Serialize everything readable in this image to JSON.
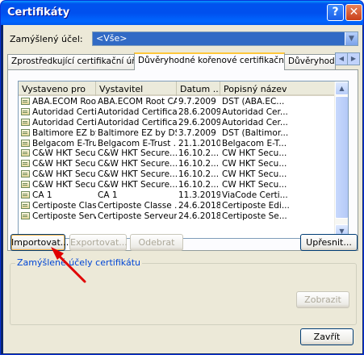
{
  "window": {
    "title": "Certifikáty",
    "help_label": "?",
    "close_label": "✕"
  },
  "purpose": {
    "label": "Zamýšlený účel:",
    "value": "<Vše>"
  },
  "tabs": [
    {
      "label": "Zprostředkující certifikační úřady"
    },
    {
      "label": "Důvěryhodné kořenové certifikační úřady"
    },
    {
      "label": "Důvěryhodní vy"
    }
  ],
  "list": {
    "columns": [
      "Vystaveno pro",
      "Vystavitel",
      "Datum ...",
      "Popisný název"
    ],
    "rows": [
      [
        "ABA.ECOM Root ...",
        "ABA.ECOM Root CA",
        "9.7.2009",
        "DST (ABA.EC..."
      ],
      [
        "Autoridad Certifi...",
        "Autoridad Certifica...",
        "28.6.2009",
        "Autoridad Cer..."
      ],
      [
        "Autoridad Certifi...",
        "Autoridad Certifica...",
        "29.6.2009",
        "Autoridad Cer..."
      ],
      [
        "Baltimore EZ by ...",
        "Baltimore EZ by DST",
        "3.7.2009",
        "DST (Baltimor..."
      ],
      [
        "Belgacom E-Tru...",
        "Belgacom E-Trust ...",
        "21.1.2010",
        "Belgacom E-T..."
      ],
      [
        "C&W HKT Secur...",
        "C&W HKT Secure...",
        "16.10.2...",
        "CW HKT Secu..."
      ],
      [
        "C&W HKT Secur...",
        "C&W HKT Secure...",
        "16.10.2...",
        "CW HKT Secu..."
      ],
      [
        "C&W HKT Secur...",
        "C&W HKT Secure...",
        "16.10.2...",
        "CW HKT Secu..."
      ],
      [
        "C&W HKT Secur...",
        "C&W HKT Secure...",
        "16.10.2...",
        "CW HKT Secu..."
      ],
      [
        "CA 1",
        "CA 1",
        "11.3.2019",
        "ViaCode Certi..."
      ],
      [
        "Certiposte Classe...",
        "Certiposte Classe ...",
        "24.6.2018",
        "Certiposte Edi..."
      ],
      [
        "Certiposte Serve...",
        "Certiposte Serveur",
        "24.6.2018",
        "Certiposte Se..."
      ]
    ]
  },
  "buttons": {
    "import": "Importovat...",
    "export": "Exportovat...",
    "remove": "Odebrat",
    "advanced": "Upřesnit...",
    "view": "Zobrazit",
    "close": "Zavřít"
  },
  "group": {
    "title": "Zamýšlené účely certifikátu"
  },
  "colors": {
    "title_bar": "#0053ee",
    "selection": "#316ac5",
    "annotation_arrow": "#e00000"
  }
}
